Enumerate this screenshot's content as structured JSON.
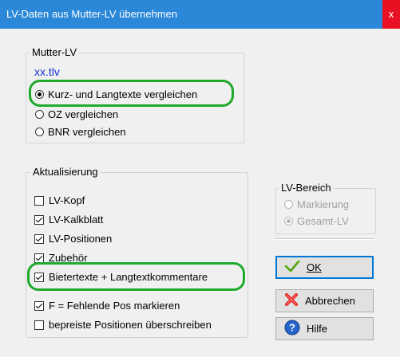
{
  "window": {
    "title": "LV-Daten aus Mutter-LV übernehmen",
    "close_glyph": "x"
  },
  "mutter_lv": {
    "legend": "Mutter-LV",
    "file": "xx.tlv",
    "options": [
      {
        "label": "Kurz- und Langtexte vergleichen",
        "selected": true
      },
      {
        "label": "OZ vergleichen",
        "selected": false
      },
      {
        "label": "BNR vergleichen",
        "selected": false
      }
    ]
  },
  "aktualisierung": {
    "legend": "Aktualisierung",
    "items": [
      {
        "label": "LV-Kopf",
        "checked": false
      },
      {
        "label": "LV-Kalkblatt",
        "checked": true
      },
      {
        "label": "LV-Positionen",
        "checked": true
      },
      {
        "label": "Zubehör",
        "checked": true
      },
      {
        "label": "Bietertexte + Langtextkommentare",
        "checked": true
      },
      {
        "label": "F = Fehlende Pos markieren",
        "checked": true
      },
      {
        "label": "bepreiste Positionen überschreiben",
        "checked": false
      }
    ]
  },
  "lv_bereich": {
    "legend": "LV-Bereich",
    "options": [
      {
        "label": "Markierung",
        "selected": false
      },
      {
        "label": "Gesamt-LV",
        "selected": true
      }
    ]
  },
  "buttons": {
    "ok": {
      "label": "OK",
      "icon": "checkmark-icon"
    },
    "cancel": {
      "label": "Abbrechen",
      "icon": "red-x-icon"
    },
    "help": {
      "label": "Hilfe",
      "icon": "question-icon"
    }
  },
  "colors": {
    "titlebar": "#2b87d8",
    "highlight": "#1faa2c",
    "link": "#1a35d6"
  }
}
